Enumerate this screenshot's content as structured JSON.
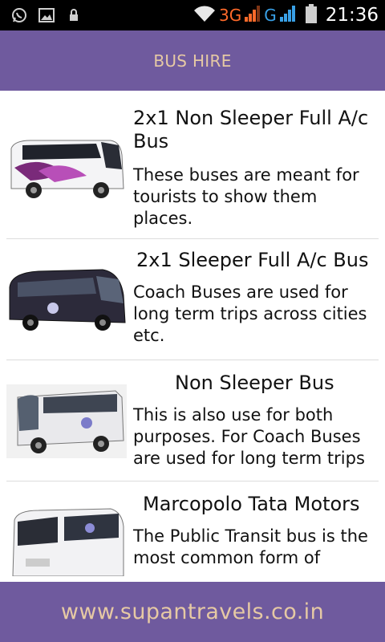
{
  "status_bar": {
    "network_3g": "3G",
    "network_g": "G",
    "time": "21:36",
    "colors": {
      "three_g": "#ff6a2a",
      "g": "#39a0e6"
    }
  },
  "header": {
    "title": "BUS HIRE"
  },
  "buses": [
    {
      "title": "2x1 Non Sleeper Full A/c Bus",
      "description": "These buses are meant for tourists to show them places."
    },
    {
      "title": "2x1 Sleeper Full A/c Bus",
      "description": "Coach Buses are used for long term trips across cities etc."
    },
    {
      "title": "Non Sleeper Bus",
      "description": "This is also use for both purposes. For Coach Buses are used for long term trips"
    },
    {
      "title": "Marcopolo Tata Motors",
      "description": "The Public Transit bus is the most common form of"
    }
  ],
  "footer": {
    "website": "www.supantravels.co.in"
  },
  "theme": {
    "bar_color": "#6f5a9e",
    "bar_text_color": "#e6c9a4"
  }
}
